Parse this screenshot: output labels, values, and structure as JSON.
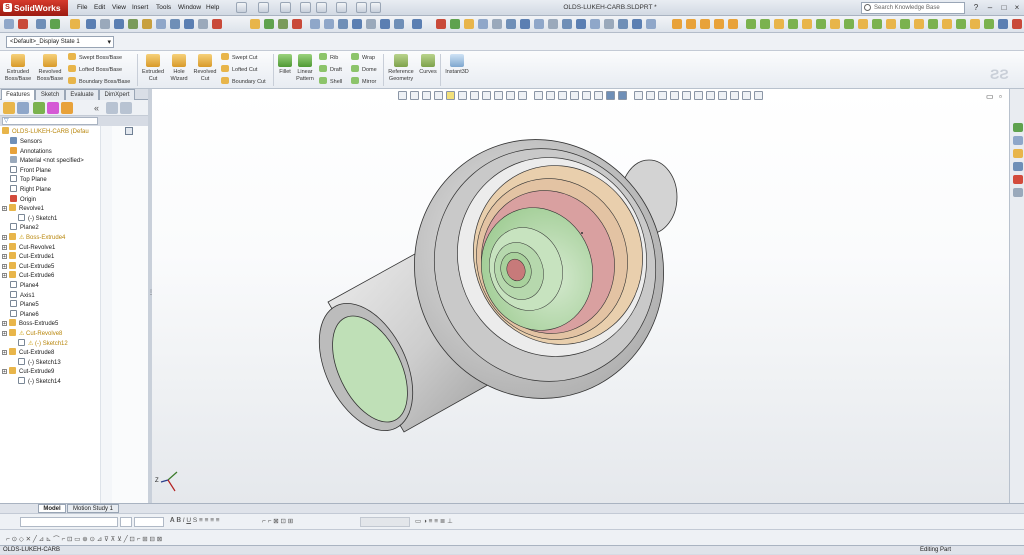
{
  "app": {
    "name": "SolidWorks"
  },
  "menu": [
    "File",
    "Edit",
    "View",
    "Insert",
    "Tools",
    "Window",
    "Help"
  ],
  "document_title": "OLDS-LUKEH-CARB.SLDPRT *",
  "search": {
    "placeholder": "Search Knowledge Base"
  },
  "window_controls": [
    "?",
    "–",
    "□",
    "×"
  ],
  "config": {
    "selected": "<Default>_Display State 1"
  },
  "ribbon": {
    "extruded_boss": "Extruded Boss/Base",
    "revolved_boss": "Revolved Boss/Base",
    "swept_boss": "Swept Boss/Base",
    "lofted_boss": "Lofted Boss/Base",
    "boundary_boss": "Boundary Boss/Base",
    "extruded_cut": "Extruded Cut",
    "hole_wizard": "Hole Wizard",
    "revolved_cut": "Revolved Cut",
    "swept_cut": "Swept Cut",
    "lofted_cut": "Lofted Cut",
    "boundary_cut": "Boundary Cut",
    "fillet": "Fillet",
    "linear_pattern": "Linear Pattern",
    "rib": "Rib",
    "draft": "Draft",
    "shell": "Shell",
    "wrap": "Wrap",
    "dome": "Dome",
    "mirror": "Mirror",
    "reference_geometry": "Reference Geometry",
    "curves": "Curves",
    "instant3d": "Instant3D"
  },
  "panel_tabs": [
    "Features",
    "Sketch",
    "Evaluate",
    "DimXpert"
  ],
  "tree": {
    "root": "OLDS-LUKEH-CARB (Defau",
    "items": [
      {
        "label": "Sensors",
        "indent": 1,
        "kind": "sensor"
      },
      {
        "label": "Annotations",
        "indent": 1,
        "kind": "annot"
      },
      {
        "label": "Material <not specified>",
        "indent": 1,
        "kind": "material"
      },
      {
        "label": "Front Plane",
        "indent": 1,
        "kind": "plane"
      },
      {
        "label": "Top Plane",
        "indent": 1,
        "kind": "plane"
      },
      {
        "label": "Right Plane",
        "indent": 1,
        "kind": "plane"
      },
      {
        "label": "Origin",
        "indent": 1,
        "kind": "origin"
      },
      {
        "label": "Revolve1",
        "indent": 0,
        "kind": "feature"
      },
      {
        "label": "(-) Sketch1",
        "indent": 2,
        "kind": "sketch"
      },
      {
        "label": "Plane2",
        "indent": 1,
        "kind": "plane"
      },
      {
        "label": "Boss-Extrude4",
        "indent": 0,
        "kind": "feature-warn"
      },
      {
        "label": "Cut-Revolve1",
        "indent": 0,
        "kind": "feature"
      },
      {
        "label": "Cut-Extrude1",
        "indent": 0,
        "kind": "feature"
      },
      {
        "label": "Cut-Extrude5",
        "indent": 0,
        "kind": "feature"
      },
      {
        "label": "Cut-Extrude6",
        "indent": 0,
        "kind": "feature"
      },
      {
        "label": "Plane4",
        "indent": 1,
        "kind": "plane"
      },
      {
        "label": "Axis1",
        "indent": 1,
        "kind": "axis"
      },
      {
        "label": "Plane5",
        "indent": 1,
        "kind": "plane"
      },
      {
        "label": "Plane6",
        "indent": 1,
        "kind": "plane"
      },
      {
        "label": "Boss-Extrude5",
        "indent": 0,
        "kind": "feature"
      },
      {
        "label": "Cut-Revolve8",
        "indent": 0,
        "kind": "feature-warn"
      },
      {
        "label": "(-) Sketch12",
        "indent": 2,
        "kind": "sketch-warn"
      },
      {
        "label": "Cut-Extrude8",
        "indent": 0,
        "kind": "feature"
      },
      {
        "label": "(-) Sketch13",
        "indent": 2,
        "kind": "sketch"
      },
      {
        "label": "Cut-Extrude9",
        "indent": 0,
        "kind": "feature"
      },
      {
        "label": "(-) Sketch14",
        "indent": 2,
        "kind": "sketch"
      }
    ]
  },
  "bottom_tabs": [
    "Model",
    "Motion Study 1"
  ],
  "status": {
    "left": "OLDS-LUKEH-CARB",
    "right": "Editing Part"
  },
  "triad": {
    "z": "Z"
  },
  "colors": {
    "green": "#bfe0b7",
    "pink": "#d99c9c",
    "tan": "#e7cfae",
    "grey": "#d9d9d9"
  }
}
